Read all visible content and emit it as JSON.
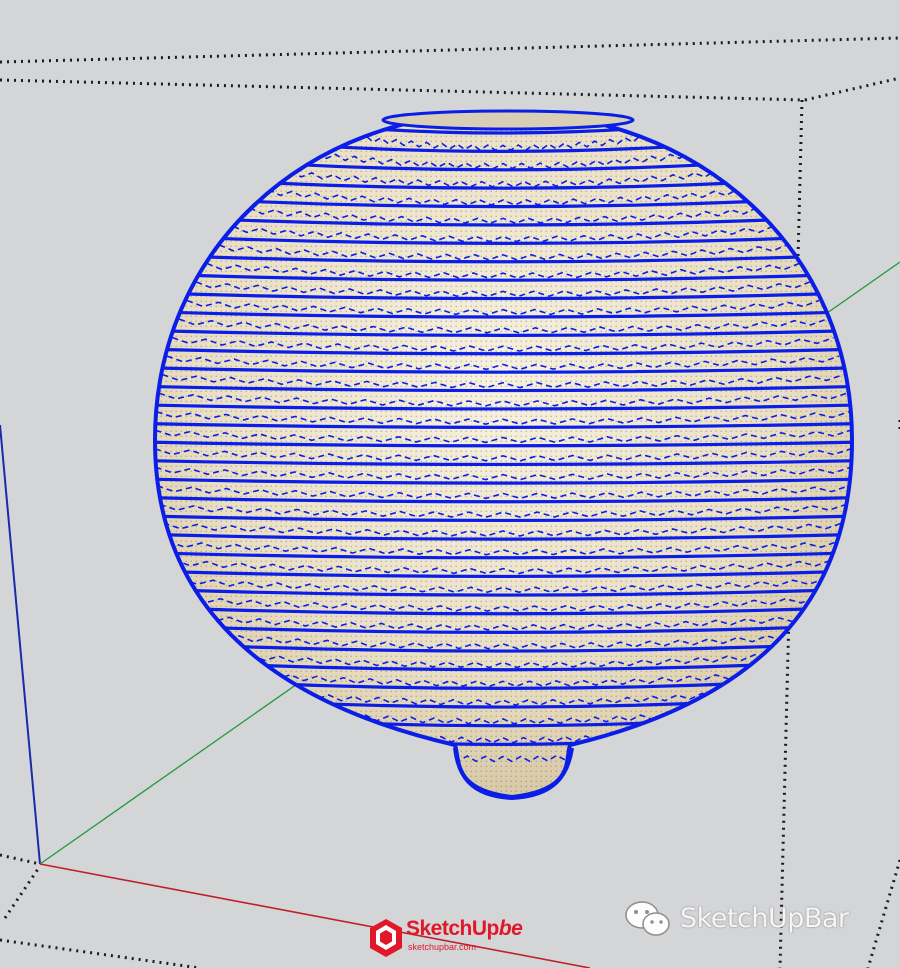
{
  "canvas": {
    "background": "#d4d5d7",
    "bounding_box_color": "#1a1a1a",
    "axis_colors": {
      "red": "#c0202a",
      "green": "#1f9a3a",
      "blue": "#1a2aa8"
    }
  },
  "model": {
    "name": "sphere-vase-model",
    "edge_color": "#0a1ee8",
    "face_color": "#efe6cc"
  },
  "logo": {
    "icon": "sketchup-logo-icon",
    "brand": "SketchUp",
    "brand_suffix": "be",
    "url": "sketchupbar.com",
    "color": "#e0182a"
  },
  "watermark": {
    "icon": "wechat-icon",
    "text": "SketchUpBar"
  }
}
